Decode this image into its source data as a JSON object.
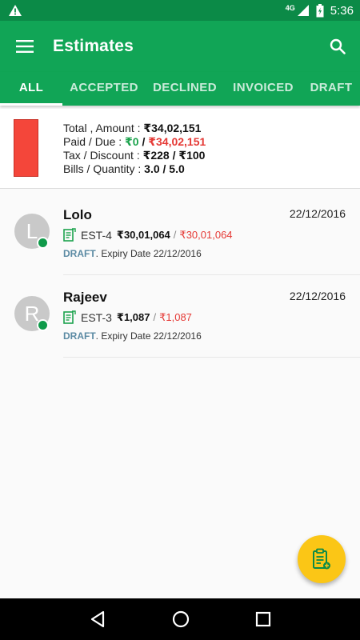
{
  "status_bar": {
    "network": "4G",
    "time": "5:36"
  },
  "app_bar": {
    "title": "Estimates",
    "menu_icon": "hamburger-menu-icon",
    "search_icon": "search-icon"
  },
  "tabs": [
    {
      "label": "ALL",
      "active": true
    },
    {
      "label": "ACCEPTED",
      "active": false
    },
    {
      "label": "DECLINED",
      "active": false
    },
    {
      "label": "INVOICED",
      "active": false
    },
    {
      "label": "DRAFT",
      "active": false
    }
  ],
  "summary": {
    "total_label": "Total , Amount : ",
    "total_value": "₹34,02,151",
    "paid_label": "Paid / Due : ",
    "paid_value": "₹0",
    "paid_sep": " / ",
    "due_value": "₹34,02,151",
    "tax_label": "Tax / Discount : ",
    "tax_value": "₹228 / ₹100",
    "bills_label": "Bills / Quantity : ",
    "bills_value": "3.0 / 5.0",
    "swatch_color": "#f4463a"
  },
  "estimates": [
    {
      "initial": "L",
      "name": "Lolo",
      "date": "22/12/2016",
      "est_no": "EST-4",
      "amount": "₹30,01,064",
      "slash": "/",
      "due": "₹30,01,064",
      "status": "DRAFT",
      "expiry": ". Expiry Date 22/12/2016"
    },
    {
      "initial": "R",
      "name": "Rajeev",
      "date": "22/12/2016",
      "est_no": "EST-3",
      "amount": "₹1,087",
      "slash": "/",
      "due": "₹1,087",
      "status": "DRAFT",
      "expiry": ". Expiry Date 22/12/2016"
    }
  ],
  "fab": {
    "icon": "clipboard-add-icon",
    "color": "#fbc616"
  },
  "colors": {
    "primary": "#11a556",
    "status_bar": "#0b8a47",
    "accent_red": "#e53935",
    "accent_green": "#1ca34d",
    "draft_text": "#5b8aa3"
  }
}
